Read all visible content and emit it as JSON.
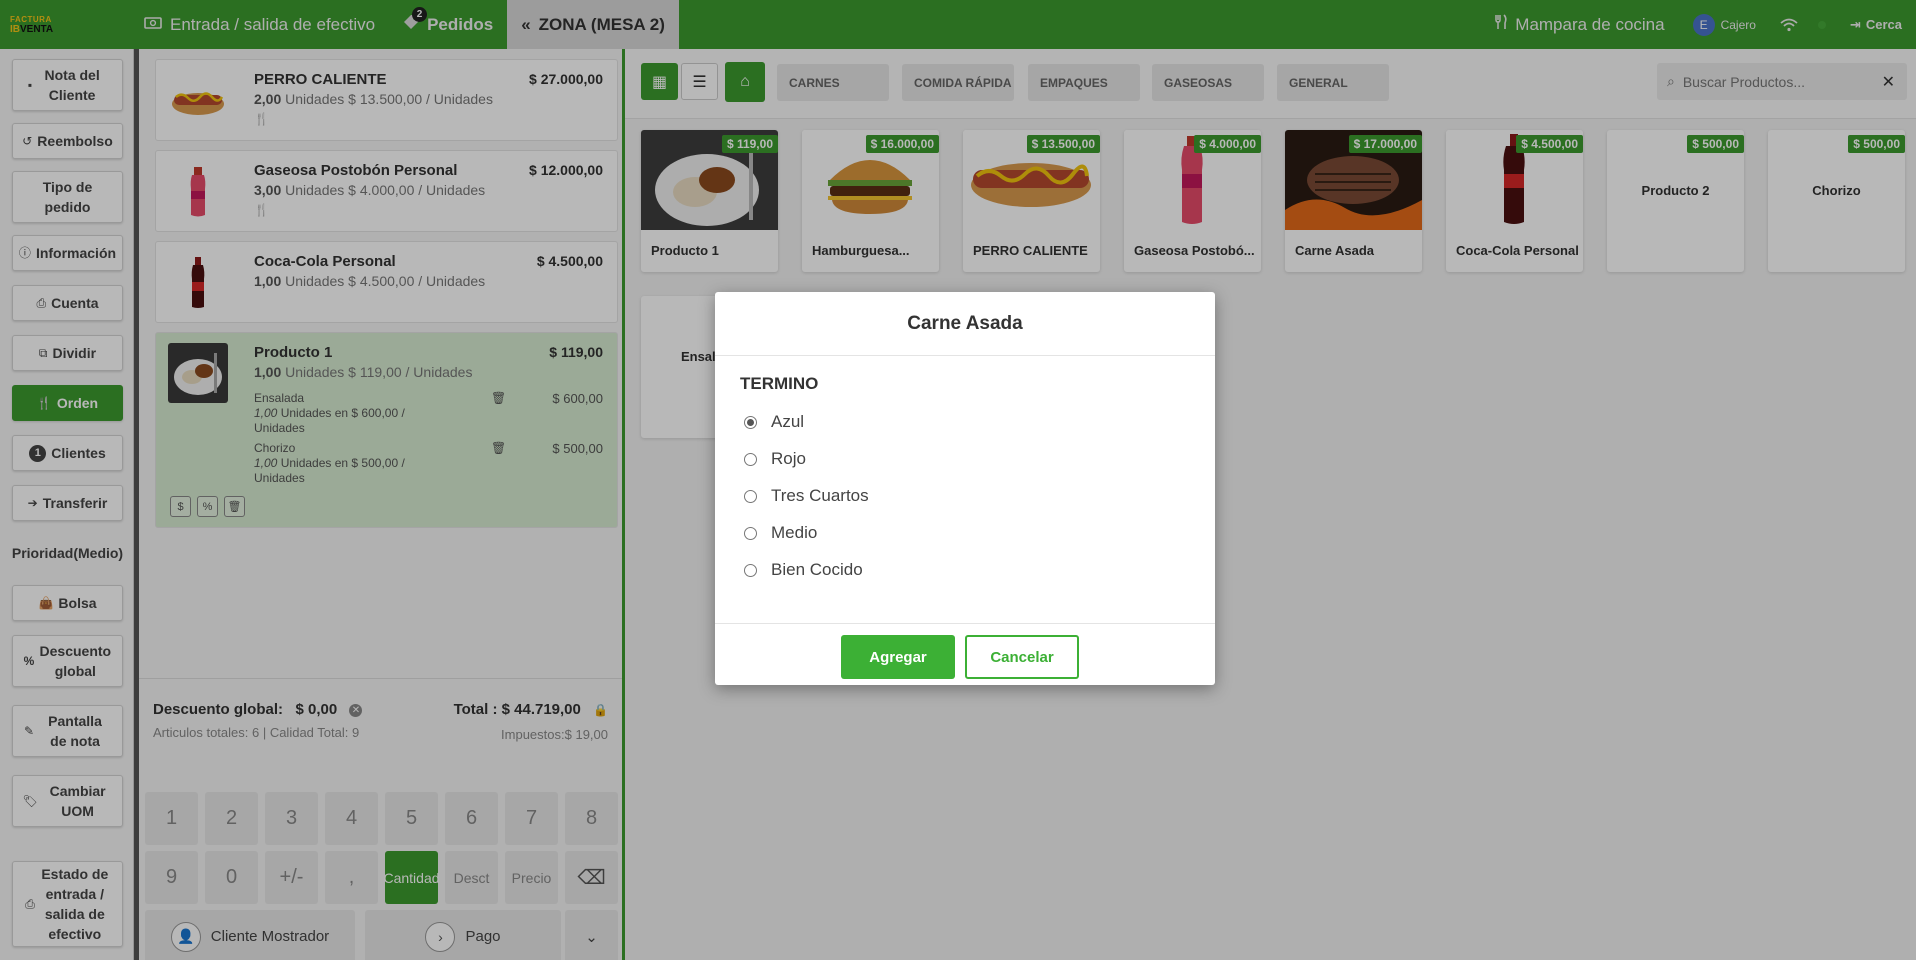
{
  "colors": {
    "brand": "#3c9a2e",
    "modal_confirm": "#3cb035"
  },
  "header": {
    "logo_top": "FACTURA",
    "logo_bottom_a": "IB",
    "logo_bottom_b": "VENTA",
    "cash_label": "Entrada / salida de efectivo",
    "orders_label": "Pedidos",
    "orders_count": "2",
    "zone_label": "ZONA (MESA 2)",
    "kitchen_label": "Mampara de cocina",
    "user_initial": "E",
    "user_name": "Cajero",
    "close_label": "Cerca"
  },
  "actions": [
    {
      "label": "Nota del Cliente",
      "icon": "note-icon"
    },
    {
      "label": "Reembolso",
      "icon": "undo-icon"
    },
    {
      "label": "Tipo de pedido",
      "icon": ""
    },
    {
      "label": "Información",
      "icon": "info-icon"
    },
    {
      "label": "Cuenta",
      "icon": "print-icon"
    },
    {
      "label": "Dividir",
      "icon": "split-icon"
    },
    {
      "label": "Orden",
      "icon": "cutlery-icon"
    },
    {
      "label": "Clientes",
      "icon": "",
      "badge": "1"
    },
    {
      "label": "Transferir",
      "icon": "arrow-right-icon"
    },
    {
      "label": "Prioridad(Medio)",
      "icon": ""
    },
    {
      "label": "Bolsa",
      "icon": "bag-icon"
    },
    {
      "label": "Descuento global",
      "icon": "percent-icon"
    },
    {
      "label": "Pantalla de nota",
      "icon": "edit-icon"
    },
    {
      "label": "Cambiar UOM",
      "icon": "tag-icon"
    },
    {
      "label": "Estado de entrada / salida de efectivo",
      "icon": "print-icon"
    }
  ],
  "order_lines": [
    {
      "name": "PERRO CALIENTE",
      "qty": "2,00",
      "detail": "Unidades $ 13.500,00 / Unidades",
      "price": "$ 27.000,00"
    },
    {
      "name": "Gaseosa Postobón Personal",
      "qty": "3,00",
      "detail": "Unidades $ 4.000,00 / Unidades",
      "price": "$ 12.000,00"
    },
    {
      "name": "Coca-Cola Personal",
      "qty": "1,00",
      "detail": "Unidades $ 4.500,00 / Unidades",
      "price": "$ 4.500,00"
    },
    {
      "name": "Producto 1",
      "qty": "1,00",
      "detail": "Unidades $ 119,00 / Unidades",
      "price": "$ 119,00"
    }
  ],
  "sub_items": [
    {
      "name": "Ensalada",
      "qty": "1,00",
      "detail": "Unidades  en  $ 600,00 / Unidades",
      "price": "$ 600,00"
    },
    {
      "name": "Chorizo",
      "qty": "1,00",
      "detail": "Unidades  en  $ 500,00 / Unidades",
      "price": "$ 500,00"
    }
  ],
  "mini_buttons": [
    "$",
    "%",
    "🗑"
  ],
  "summary": {
    "discount_label": "Descuento global:",
    "discount_value": "$ 0,00",
    "articles": "Articulos totales: 6  |  Calidad Total: 9",
    "total": "Total : $ 44.719,00",
    "taxes": "Impuestos:$ 19,00"
  },
  "numpad": {
    "row1": [
      "1",
      "2",
      "3",
      "4",
      "5",
      "6",
      "7",
      "8"
    ],
    "row2": [
      "9",
      "0",
      "+/-",
      ",",
      "Cantidad",
      "Desct",
      "Precio",
      "⌫"
    ],
    "customer_label": "Cliente Mostrador",
    "pay_label": "Pago"
  },
  "categories": [
    "CARNES",
    "COMIDA RÁPIDA",
    "EMPAQUES",
    "GASEOSAS",
    "GENERAL"
  ],
  "search": {
    "placeholder": "Buscar Productos..."
  },
  "products": [
    {
      "name": "Producto 1",
      "price": "$ 119,00"
    },
    {
      "name": "Hamburguesa...",
      "price": "$ 16.000,00"
    },
    {
      "name": "PERRO CALIENTE",
      "price": "$ 13.500,00"
    },
    {
      "name": "Gaseosa Postobó...",
      "price": "$ 4.000,00"
    },
    {
      "name": "Carne Asada",
      "price": "$ 17.000,00"
    },
    {
      "name": "Coca-Cola Personal",
      "price": "$ 4.500,00"
    },
    {
      "name": "Producto 2",
      "price": "$ 500,00"
    },
    {
      "name": "Chorizo",
      "price": "$ 500,00"
    },
    {
      "name": "Ensalada",
      "price": ""
    }
  ],
  "modal": {
    "title": "Carne Asada",
    "group": "TERMINO",
    "options": [
      "Azul",
      "Rojo",
      "Tres Cuartos",
      "Medio",
      "Bien Cocido"
    ],
    "selected": "Azul",
    "confirm_label": "Agregar",
    "cancel_label": "Cancelar"
  }
}
